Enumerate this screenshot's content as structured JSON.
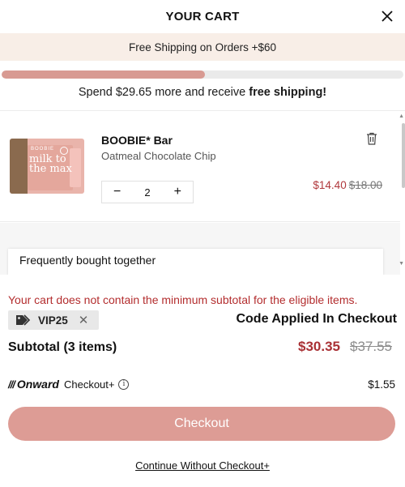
{
  "header": {
    "title": "YOUR CART",
    "close_icon": "close-icon"
  },
  "shipping_banner": {
    "text": "Free Shipping on Orders +$60"
  },
  "progress": {
    "fraction": 0.506
  },
  "spend_message": {
    "prefix": "Spend $29.65 more and receive ",
    "bold": "free shipping!"
  },
  "cart": {
    "items": [
      {
        "name": "BOOBIE* Bar",
        "variant": "Oatmeal Chocolate Chip",
        "image_text": "milk to the max",
        "image_brand": "BOOBIE",
        "quantity": "2",
        "decrement_label": "−",
        "increment_label": "+",
        "sale_price": "$14.40",
        "original_price": "$18.00"
      }
    ],
    "frequently_bought_title": "Frequently bought together"
  },
  "warning": "Your cart does not contain the minimum subtotal for the eligible items.",
  "coupon": {
    "code": "VIP25",
    "remove_label": "✕",
    "status": "Code Applied In Checkout"
  },
  "subtotal": {
    "label": "Subtotal (3 items)",
    "sale": "$30.35",
    "original": "$37.55"
  },
  "onward": {
    "mark": "///",
    "brand": "Onward",
    "checkout_label": "Checkout+",
    "info_label": "i",
    "price": "$1.55"
  },
  "checkout_button": "Checkout",
  "continue_link": "Continue Without Checkout+",
  "colors": {
    "accent": "#dd9c95",
    "sale": "#b0383c",
    "banner": "#f8eee7",
    "progress": "#d89a92"
  }
}
